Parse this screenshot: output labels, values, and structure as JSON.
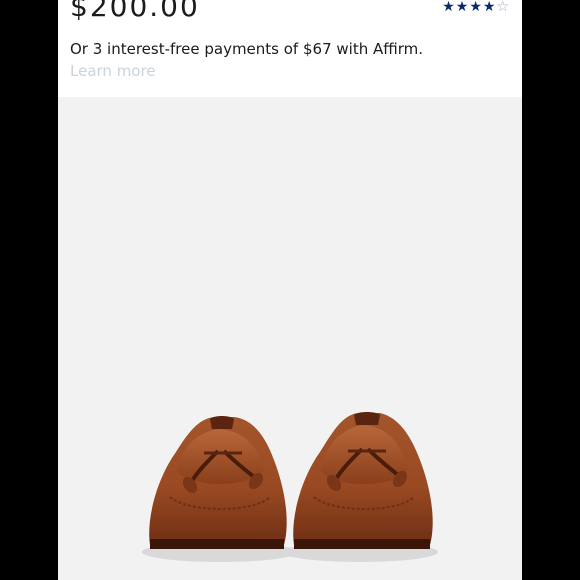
{
  "product": {
    "price": "$200.00",
    "rating": {
      "stars_filled": 4,
      "stars_total": 5
    },
    "affirm_text": "Or 3 interest-free payments of $67 with Affirm.",
    "learn_more": "Learn more",
    "image": {
      "subject": "brown leather tassel loafers",
      "background_color": "#f2f2f2"
    }
  },
  "colors": {
    "text": "#1b1b1b",
    "star": "#0a2a6b",
    "link": "#c9d3dd",
    "leather": "#9e4f25",
    "side_bars": "#000000"
  }
}
